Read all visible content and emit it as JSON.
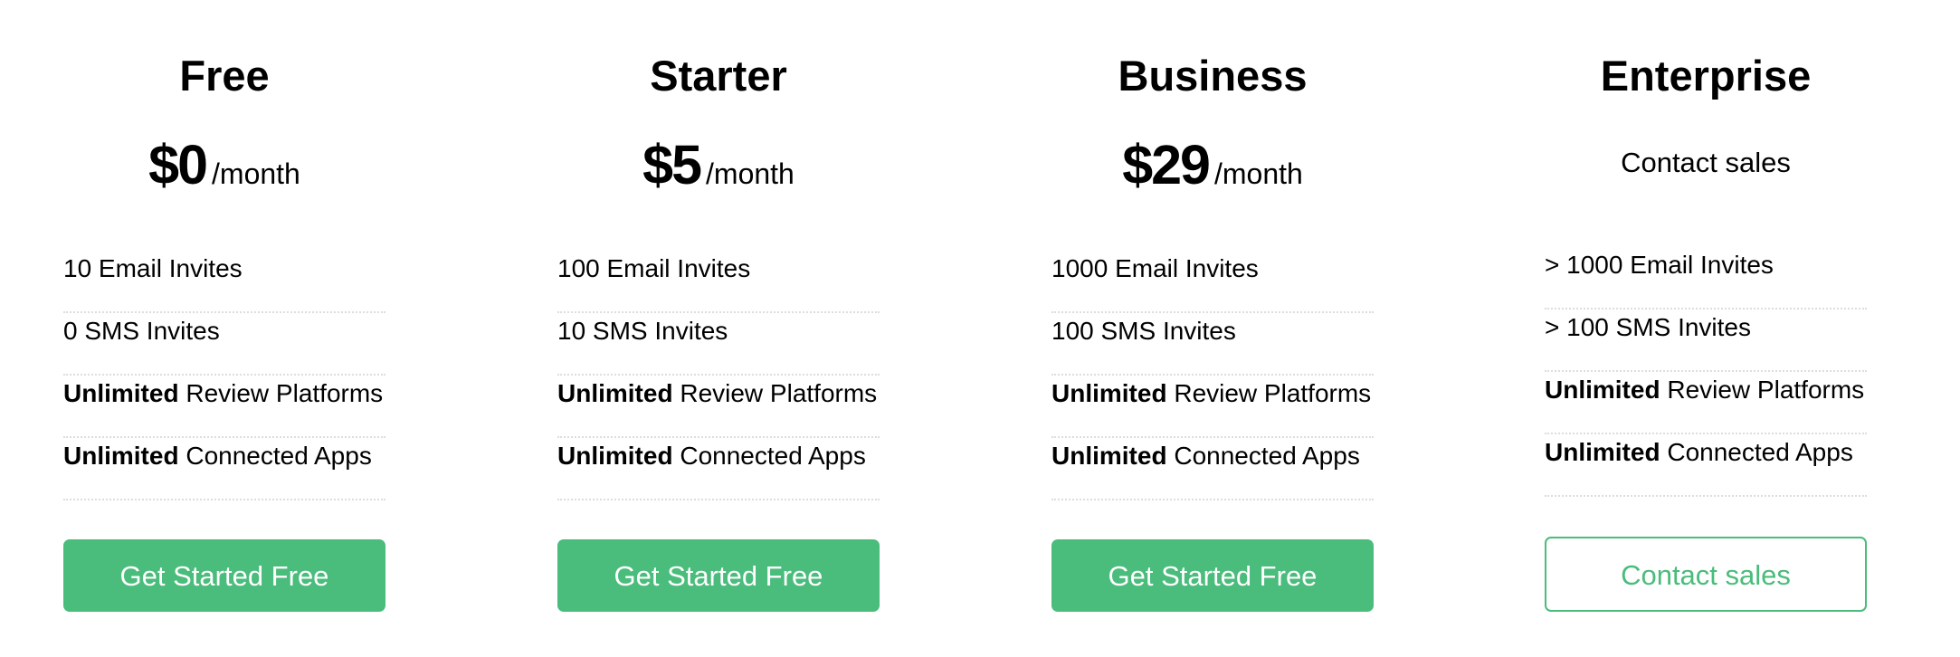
{
  "theme": {
    "accent": "#4abc7b",
    "divider": "#dddddd"
  },
  "plans": [
    {
      "name": "Free",
      "price": {
        "amount": "$0",
        "period": "/month"
      },
      "features": [
        {
          "strong": "",
          "text": "10 Email Invites"
        },
        {
          "strong": "",
          "text": "0 SMS Invites"
        },
        {
          "strong": "Unlimited",
          "text": " Review Platforms"
        },
        {
          "strong": "Unlimited",
          "text": " Connected Apps"
        }
      ],
      "cta": {
        "label": "Get Started Free",
        "style": "filled"
      }
    },
    {
      "name": "Starter",
      "price": {
        "amount": "$5",
        "period": "/month"
      },
      "features": [
        {
          "strong": "",
          "text": "100 Email Invites"
        },
        {
          "strong": "",
          "text": "10 SMS Invites"
        },
        {
          "strong": "Unlimited",
          "text": " Review Platforms"
        },
        {
          "strong": "Unlimited",
          "text": " Connected Apps"
        }
      ],
      "cta": {
        "label": "Get Started Free",
        "style": "filled"
      }
    },
    {
      "name": "Business",
      "price": {
        "amount": "$29",
        "period": "/month"
      },
      "features": [
        {
          "strong": "",
          "text": "1000 Email Invites"
        },
        {
          "strong": "",
          "text": "100 SMS Invites"
        },
        {
          "strong": "Unlimited",
          "text": " Review Platforms"
        },
        {
          "strong": "Unlimited",
          "text": " Connected Apps"
        }
      ],
      "cta": {
        "label": "Get Started Free",
        "style": "filled"
      }
    },
    {
      "name": "Enterprise",
      "price": {
        "contact": "Contact sales"
      },
      "features": [
        {
          "strong": "",
          "text": "> 1000 Email Invites"
        },
        {
          "strong": "",
          "text": "> 100 SMS Invites"
        },
        {
          "strong": "Unlimited",
          "text": " Review Platforms"
        },
        {
          "strong": "Unlimited",
          "text": " Connected Apps"
        }
      ],
      "cta": {
        "label": "Contact sales",
        "style": "outline"
      }
    }
  ]
}
